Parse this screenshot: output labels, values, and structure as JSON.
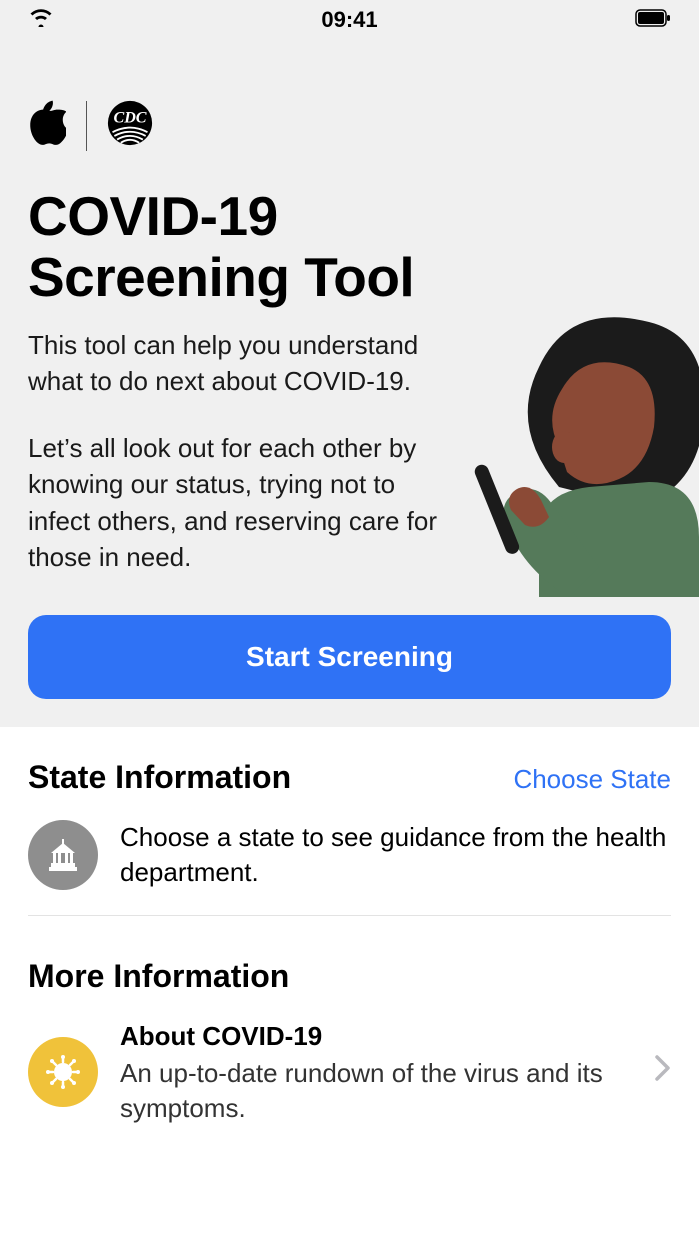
{
  "status_bar": {
    "time": "09:41"
  },
  "header": {
    "title": "COVID-19 Screening Tool",
    "paragraph1": "This tool can help you understand what to do next about COVID-19.",
    "paragraph2": "Let’s all look out for each other by knowing our status, trying not to infect others, and reserving care for those in need.",
    "cta_label": "Start Screening"
  },
  "state_info": {
    "title": "State Information",
    "action": "Choose State",
    "desc": "Choose a state to see guidance from the health department."
  },
  "more_info": {
    "title": "More Information",
    "items": [
      {
        "title": "About COVID-19",
        "desc": "An up-to-date rundown of the virus and its symptoms."
      }
    ]
  },
  "colors": {
    "primary": "#2f72f5",
    "hero_bg": "#f0f0f0",
    "icon_gray": "#8e8e8e",
    "icon_yellow": "#f0c23a"
  }
}
